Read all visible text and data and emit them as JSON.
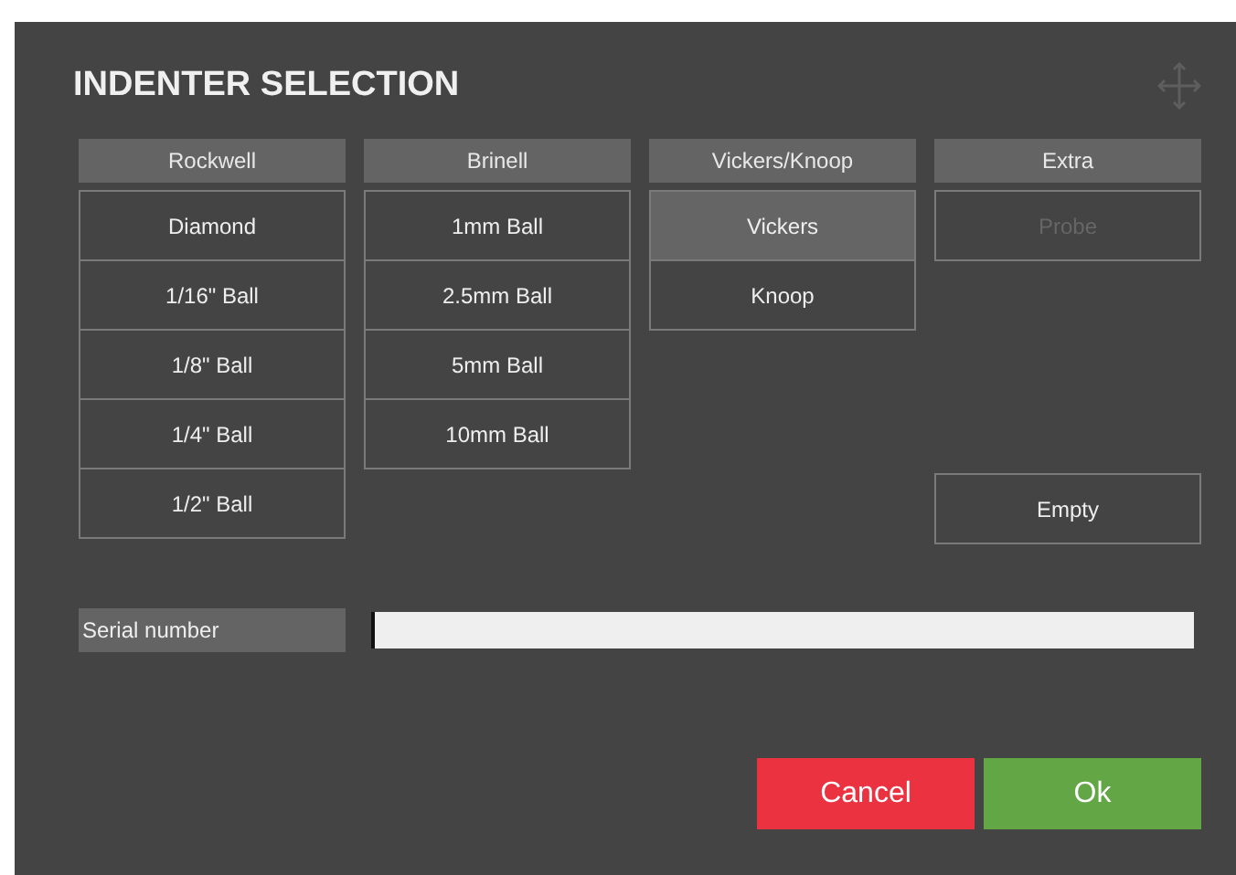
{
  "dialog": {
    "title": "INDENTER SELECTION"
  },
  "columns": [
    {
      "header": "Rockwell",
      "items": [
        {
          "label": "Diamond",
          "selected": false,
          "disabled": false
        },
        {
          "label": "1/16\" Ball",
          "selected": false,
          "disabled": false
        },
        {
          "label": "1/8\" Ball",
          "selected": false,
          "disabled": false
        },
        {
          "label": "1/4\" Ball",
          "selected": false,
          "disabled": false
        },
        {
          "label": "1/2\" Ball",
          "selected": false,
          "disabled": false
        }
      ]
    },
    {
      "header": "Brinell",
      "items": [
        {
          "label": "1mm Ball",
          "selected": false,
          "disabled": false
        },
        {
          "label": "2.5mm Ball",
          "selected": false,
          "disabled": false
        },
        {
          "label": "5mm Ball",
          "selected": false,
          "disabled": false
        },
        {
          "label": "10mm Ball",
          "selected": false,
          "disabled": false
        }
      ]
    },
    {
      "header": "Vickers/Knoop",
      "items": [
        {
          "label": "Vickers",
          "selected": true,
          "disabled": false
        },
        {
          "label": "Knoop",
          "selected": false,
          "disabled": false
        }
      ]
    },
    {
      "header": "Extra",
      "items": [
        {
          "label": "Probe",
          "selected": false,
          "disabled": true
        }
      ],
      "bottom_items": [
        {
          "label": "Empty",
          "selected": false,
          "disabled": false
        }
      ]
    }
  ],
  "serial": {
    "label": "Serial number"
  },
  "buttons": [
    {
      "label": "Cancel",
      "kind": "cancel"
    },
    {
      "label": "Ok",
      "kind": "ok"
    }
  ]
}
